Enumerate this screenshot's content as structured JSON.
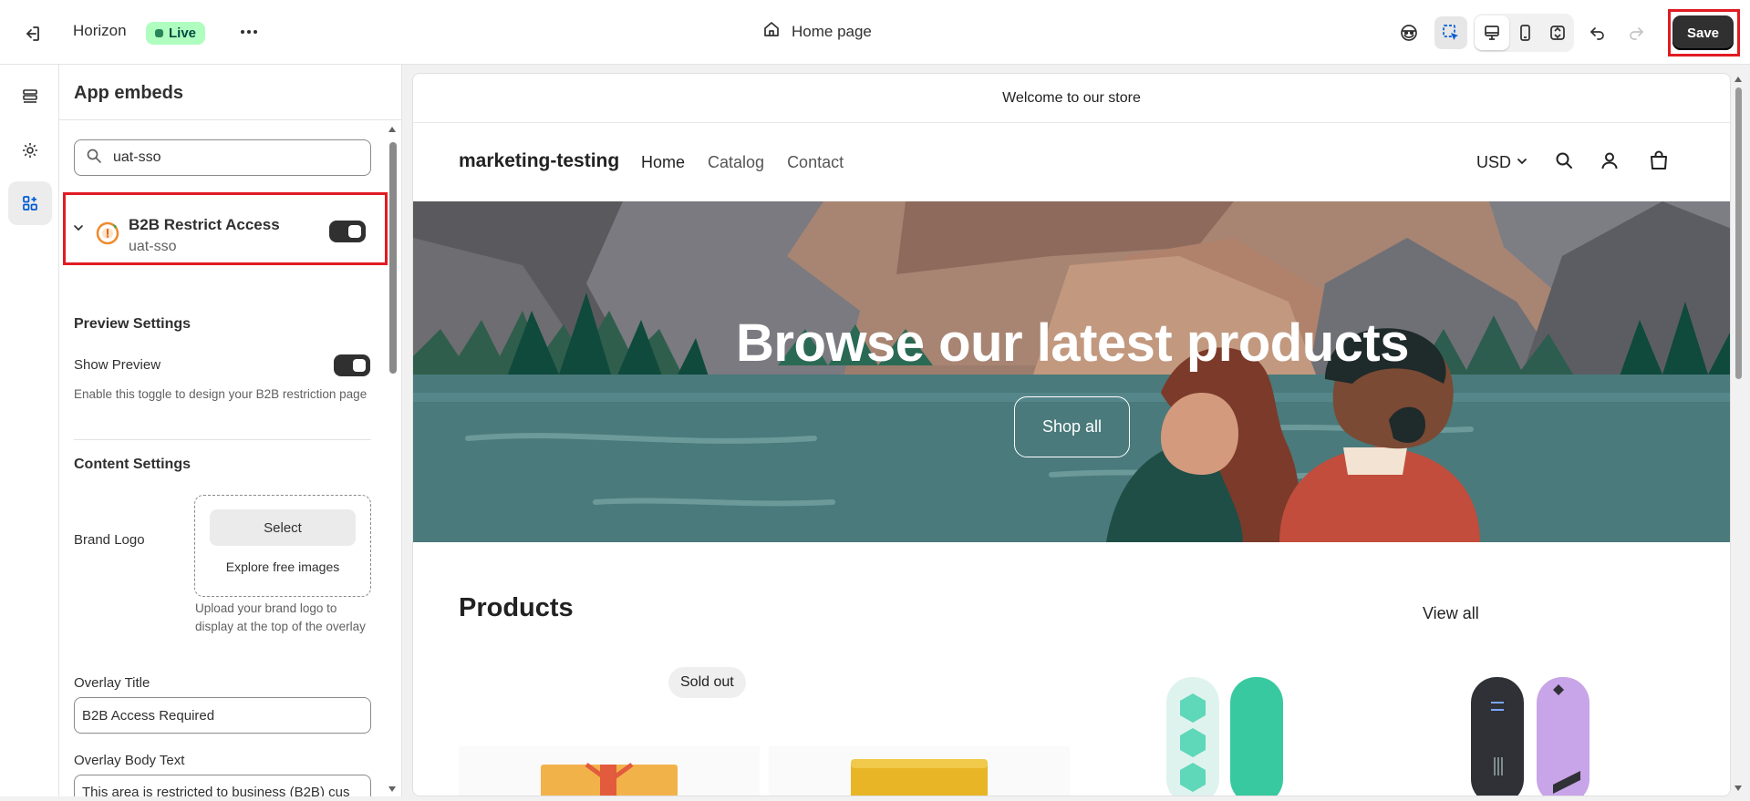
{
  "topbar": {
    "theme_name": "Horizon",
    "live_badge": "Live",
    "page_name": "Home page",
    "save_label": "Save"
  },
  "panel": {
    "title": "App embeds",
    "search": {
      "value": "uat-sso",
      "placeholder": "Search"
    },
    "embed": {
      "name": "B2B Restrict Access",
      "app": "uat-sso",
      "enabled": true
    },
    "preview_settings": {
      "title": "Preview Settings",
      "show_preview_label": "Show Preview",
      "show_preview_enabled": true,
      "show_preview_help": "Enable this toggle to design your B2B restriction page"
    },
    "content_settings": {
      "title": "Content Settings",
      "brand_logo_label": "Brand Logo",
      "select_label": "Select",
      "explore_label": "Explore free images",
      "brand_logo_help": "Upload your brand logo to display at the top of the overlay",
      "overlay_title_label": "Overlay Title",
      "overlay_title_value": "B2B Access Required",
      "overlay_body_label": "Overlay Body Text",
      "overlay_body_value": "This area is restricted to business (B2B) cus"
    }
  },
  "preview": {
    "announcement": "Welcome to our store",
    "brand": "marketing-testing",
    "nav": [
      "Home",
      "Catalog",
      "Contact"
    ],
    "currency": "USD",
    "hero_title": "Browse our latest products",
    "hero_button": "Shop all",
    "products_title": "Products",
    "view_all": "View all",
    "sold_out_badge": "Sold out"
  },
  "colors": {
    "live_bg": "#affebf",
    "highlight": "#e11b22",
    "save_bg": "#303030"
  }
}
